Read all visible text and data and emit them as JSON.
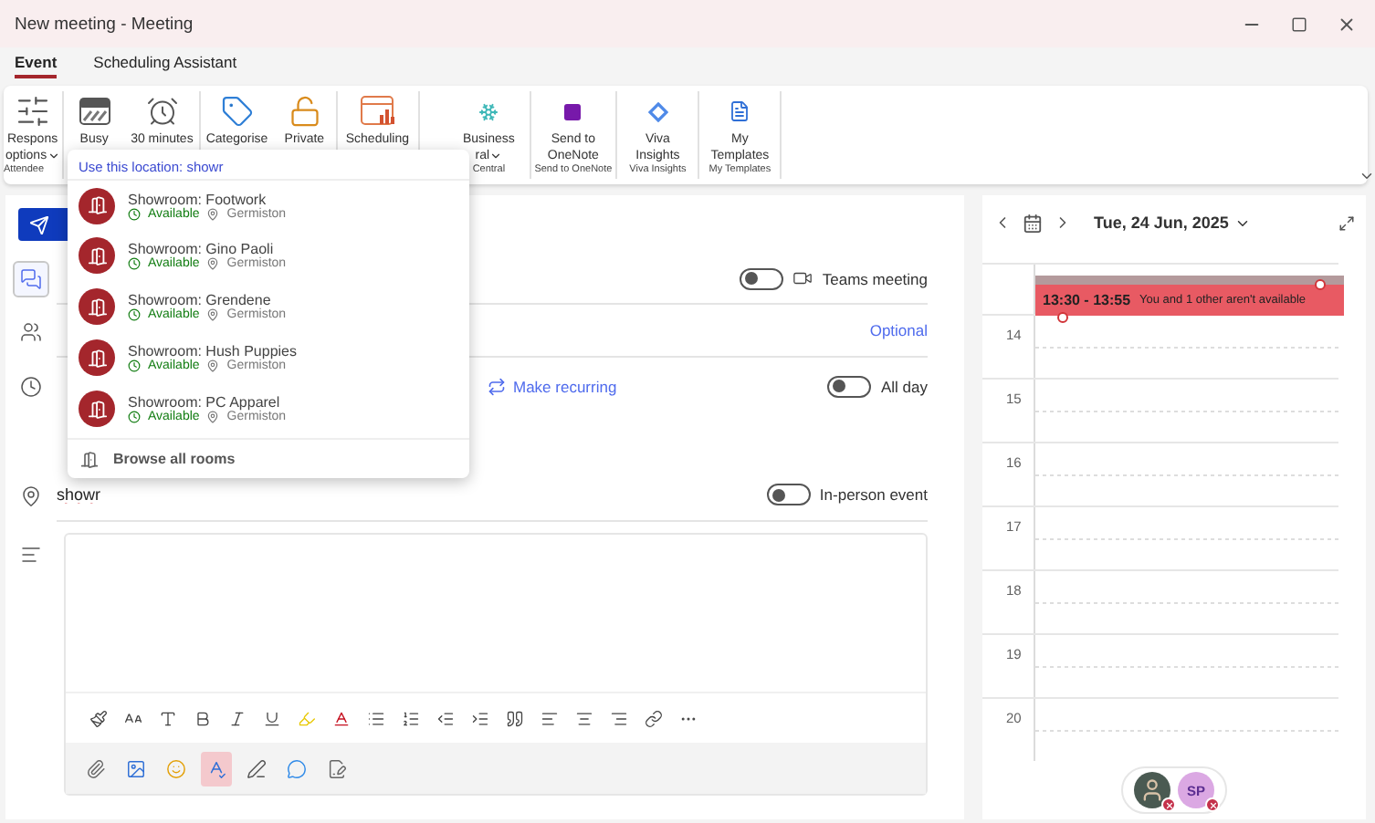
{
  "window": {
    "title": "New meeting - Meeting"
  },
  "tabs": [
    {
      "label": "Event",
      "selected": true
    },
    {
      "label": "Scheduling Assistant",
      "selected": false
    }
  ],
  "ribbon": {
    "groups": [
      {
        "label": "Attendee",
        "items": [
          {
            "kind": "response",
            "lines": [
              "Respons",
              "options"
            ],
            "dropdown": true
          }
        ]
      },
      {
        "items": [
          {
            "kind": "busy",
            "lines": [
              "Busy"
            ]
          },
          {
            "kind": "reminder",
            "lines": [
              "30 minutes"
            ]
          }
        ]
      },
      {
        "items": [
          {
            "kind": "categorise",
            "lines": [
              "Categorise"
            ]
          },
          {
            "kind": "private",
            "lines": [
              "Private"
            ]
          }
        ]
      },
      {
        "items": [
          {
            "kind": "scheduling",
            "lines": [
              "Scheduling"
            ]
          }
        ]
      },
      {
        "label": "Central",
        "items": [
          {
            "kind": "business",
            "lines": [
              "Business",
              "ral"
            ],
            "dropdown": true
          }
        ]
      },
      {
        "label": "Send to OneNote",
        "items": [
          {
            "kind": "onenote",
            "lines": [
              "Send to",
              "OneNote"
            ]
          }
        ]
      },
      {
        "label": "Viva Insights",
        "items": [
          {
            "kind": "viva",
            "lines": [
              "Viva",
              "Insights"
            ]
          }
        ]
      },
      {
        "label": "My Templates",
        "items": [
          {
            "kind": "templates",
            "lines": [
              "My",
              "Templates"
            ]
          }
        ]
      }
    ]
  },
  "location_menu": {
    "header": "Use this location: showr",
    "rooms": [
      {
        "name": "Showroom: Footwork",
        "status": "Available",
        "place": "Germiston"
      },
      {
        "name": "Showroom: Gino Paoli",
        "status": "Available",
        "place": "Germiston"
      },
      {
        "name": "Showroom: Grendene",
        "status": "Available",
        "place": "Germiston"
      },
      {
        "name": "Showroom: Hush Puppies",
        "status": "Available",
        "place": "Germiston"
      },
      {
        "name": "Showroom: PC Apparel",
        "status": "Available",
        "place": "Germiston"
      }
    ],
    "browse": "Browse all rooms"
  },
  "form": {
    "section_icons": [
      {
        "kind": "chat",
        "selected": true
      },
      {
        "kind": "people",
        "selected": false
      },
      {
        "kind": "time",
        "selected": false
      },
      {
        "kind": "location",
        "selected": false
      },
      {
        "kind": "body",
        "selected": false
      }
    ],
    "teams": {
      "label": "Teams meeting",
      "on": false
    },
    "optional": "Optional",
    "recurring": "Make recurring",
    "all_day": {
      "label": "All day",
      "on": false
    },
    "location": {
      "value": "showr"
    },
    "in_person": {
      "label": "In-person event",
      "on": false
    }
  },
  "editor": {
    "format_tools": [
      {
        "kind": "painter"
      },
      {
        "kind": "font-size"
      },
      {
        "kind": "grow"
      },
      {
        "kind": "bold"
      },
      {
        "kind": "italic"
      },
      {
        "kind": "underline"
      },
      {
        "kind": "highlight"
      },
      {
        "kind": "font-color"
      },
      {
        "kind": "bullets"
      },
      {
        "kind": "numbers"
      },
      {
        "kind": "outdent"
      },
      {
        "kind": "indent"
      },
      {
        "kind": "quote"
      },
      {
        "kind": "left"
      },
      {
        "kind": "center"
      },
      {
        "kind": "right"
      },
      {
        "kind": "link"
      },
      {
        "kind": "more"
      }
    ],
    "insert_tools": [
      {
        "kind": "attach",
        "selected": false
      },
      {
        "kind": "picture",
        "selected": false
      },
      {
        "kind": "emoji",
        "selected": false
      },
      {
        "kind": "spelling",
        "selected": true
      },
      {
        "kind": "draw",
        "selected": false
      },
      {
        "kind": "loop",
        "selected": false
      },
      {
        "kind": "signature",
        "selected": false
      }
    ]
  },
  "calendar": {
    "date": "Tue, 24 Jun, 2025",
    "hours": [
      "14",
      "15",
      "16",
      "17",
      "18",
      "19",
      "20"
    ],
    "event": {
      "time": "13:30 - 13:55",
      "note": "You and 1 other aren't available"
    },
    "attendees": [
      {
        "kind": "photo",
        "unavailable": true
      },
      {
        "kind": "initials",
        "initials": "SP",
        "color": "#dba8e3",
        "unavailable": true
      }
    ]
  }
}
